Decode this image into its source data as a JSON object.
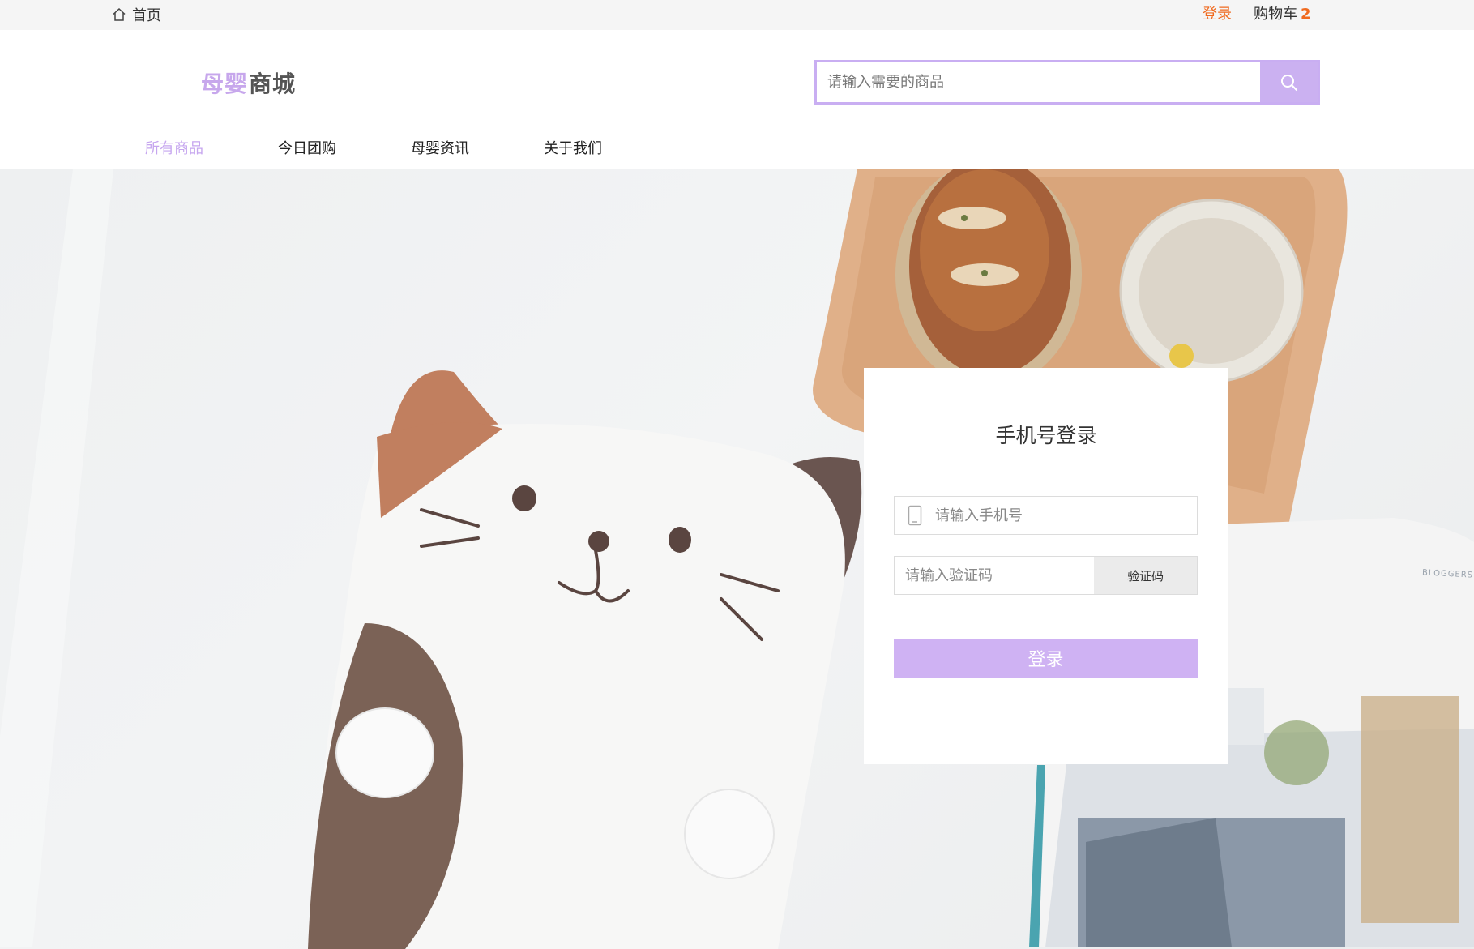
{
  "topbar": {
    "home_label": "首页",
    "login_label": "登录",
    "cart_label": "购物车",
    "cart_count": "2"
  },
  "header": {
    "logo_part1": "母婴",
    "logo_part2": "商城",
    "search_placeholder": "请输入需要的商品"
  },
  "nav": {
    "items": [
      {
        "label": "所有商品",
        "active": true
      },
      {
        "label": "今日团购",
        "active": false
      },
      {
        "label": "母婴资讯",
        "active": false
      },
      {
        "label": "关于我们",
        "active": false
      }
    ]
  },
  "login_form": {
    "title": "手机号登录",
    "phone_placeholder": "请输入手机号",
    "code_placeholder": "请输入验证码",
    "code_button": "验证码",
    "submit_label": "登录"
  },
  "hero_text": {
    "magazine_label": "BLOGGERS"
  },
  "colors": {
    "accent": "#c9aef2",
    "accent_button": "#cfb2f3",
    "link_orange": "#f06a1f"
  }
}
